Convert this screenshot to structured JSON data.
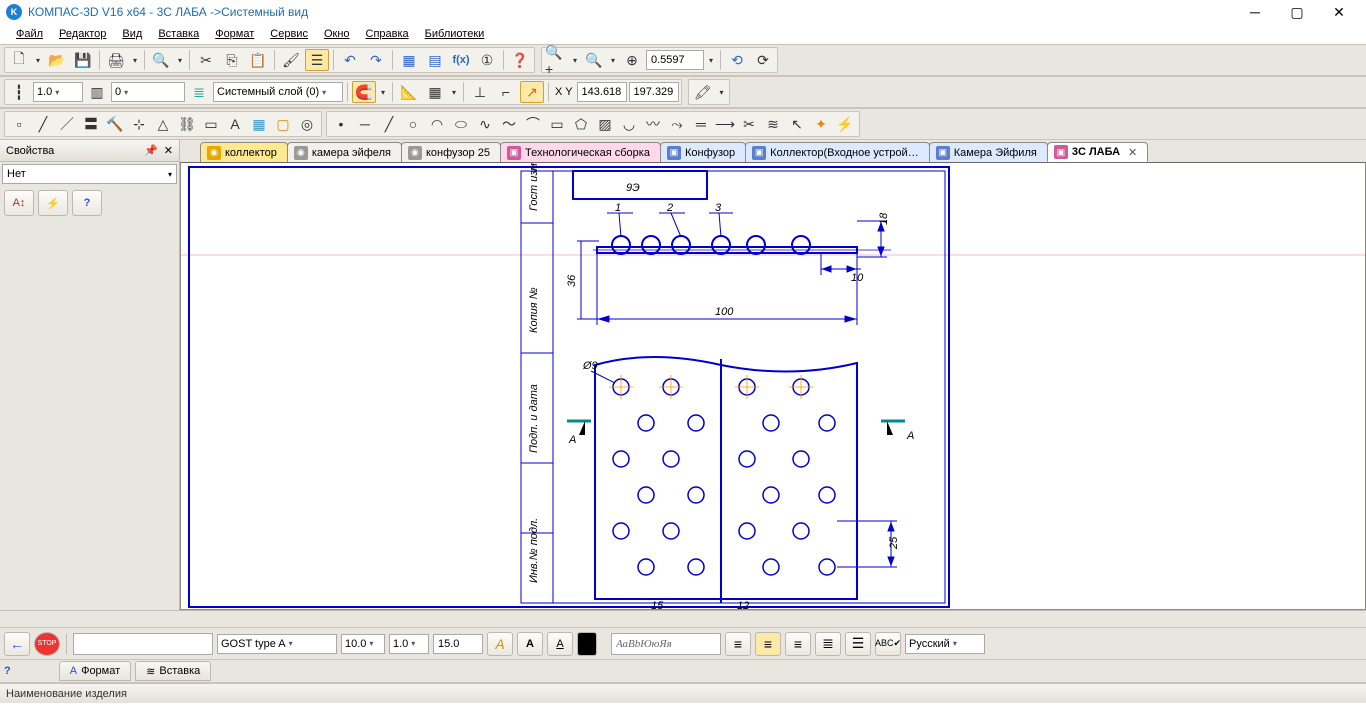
{
  "app": {
    "title": "КОМПАС-3D V16  x64 - 3С ЛАБА ->Системный вид"
  },
  "menu": {
    "file": "Файл",
    "edit": "Редактор",
    "view": "Вид",
    "insert": "Вставка",
    "format": "Формат",
    "service": "Сервис",
    "window": "Окно",
    "help": "Справка",
    "libs": "Библиотеки"
  },
  "toolbar": {
    "zoom_value": "0.5597",
    "line_width": "1.0",
    "line_type": "0",
    "layer_label": "Системный слой (0)",
    "coord_x": "143.618",
    "coord_y": "197.329",
    "xy_label": "X Y"
  },
  "props": {
    "title": "Свойства",
    "value": "Нет"
  },
  "tabs": [
    {
      "label": "коллектор",
      "color": "#ffe58a",
      "iconbg": "#e7a800"
    },
    {
      "label": "камера эйфеля",
      "color": "#e6e6e6",
      "iconbg": "#808080"
    },
    {
      "label": "конфузор 25",
      "color": "#e6e6e6",
      "iconbg": "#808080"
    },
    {
      "label": "Технологическая сборка",
      "color": "#ffd6e6",
      "iconbg": "#d05a9c"
    },
    {
      "label": "Конфузор",
      "color": "#d8e7ff",
      "iconbg": "#5a7fd0"
    },
    {
      "label": "Коллектор(Входное устрой…",
      "color": "#d8e7ff",
      "iconbg": "#5a7fd0"
    },
    {
      "label": "Камера Эйфиля",
      "color": "#d8e7ff",
      "iconbg": "#5a7fd0"
    },
    {
      "label": "3С ЛАБА",
      "color": "#ffffff",
      "iconbg": "#d05a9c",
      "active": true
    }
  ],
  "bottom": {
    "font": "GOST type A",
    "size": "10.0",
    "stretch": "1.0",
    "spacing": "15.0",
    "sample": "АаBbЮюЯя",
    "lang": "Русский",
    "tab_format": "Формат",
    "tab_insert": "Вставка"
  },
  "status": {
    "text": "Наименование изделия"
  },
  "drawing": {
    "title_block": "9Э",
    "callouts": [
      "1",
      "2",
      "3"
    ],
    "dim_18": "18",
    "dim_10": "10",
    "dim_36": "36",
    "dim_100": "100",
    "dim_25": "25",
    "dim_15": "15",
    "dim_12": "12",
    "dia": "Ø9",
    "section_left": "А",
    "section_right": "А",
    "frame_notes": [
      "Гост изменен",
      "Копия №",
      "Подп. и дата",
      "Инв.№ подл."
    ]
  }
}
